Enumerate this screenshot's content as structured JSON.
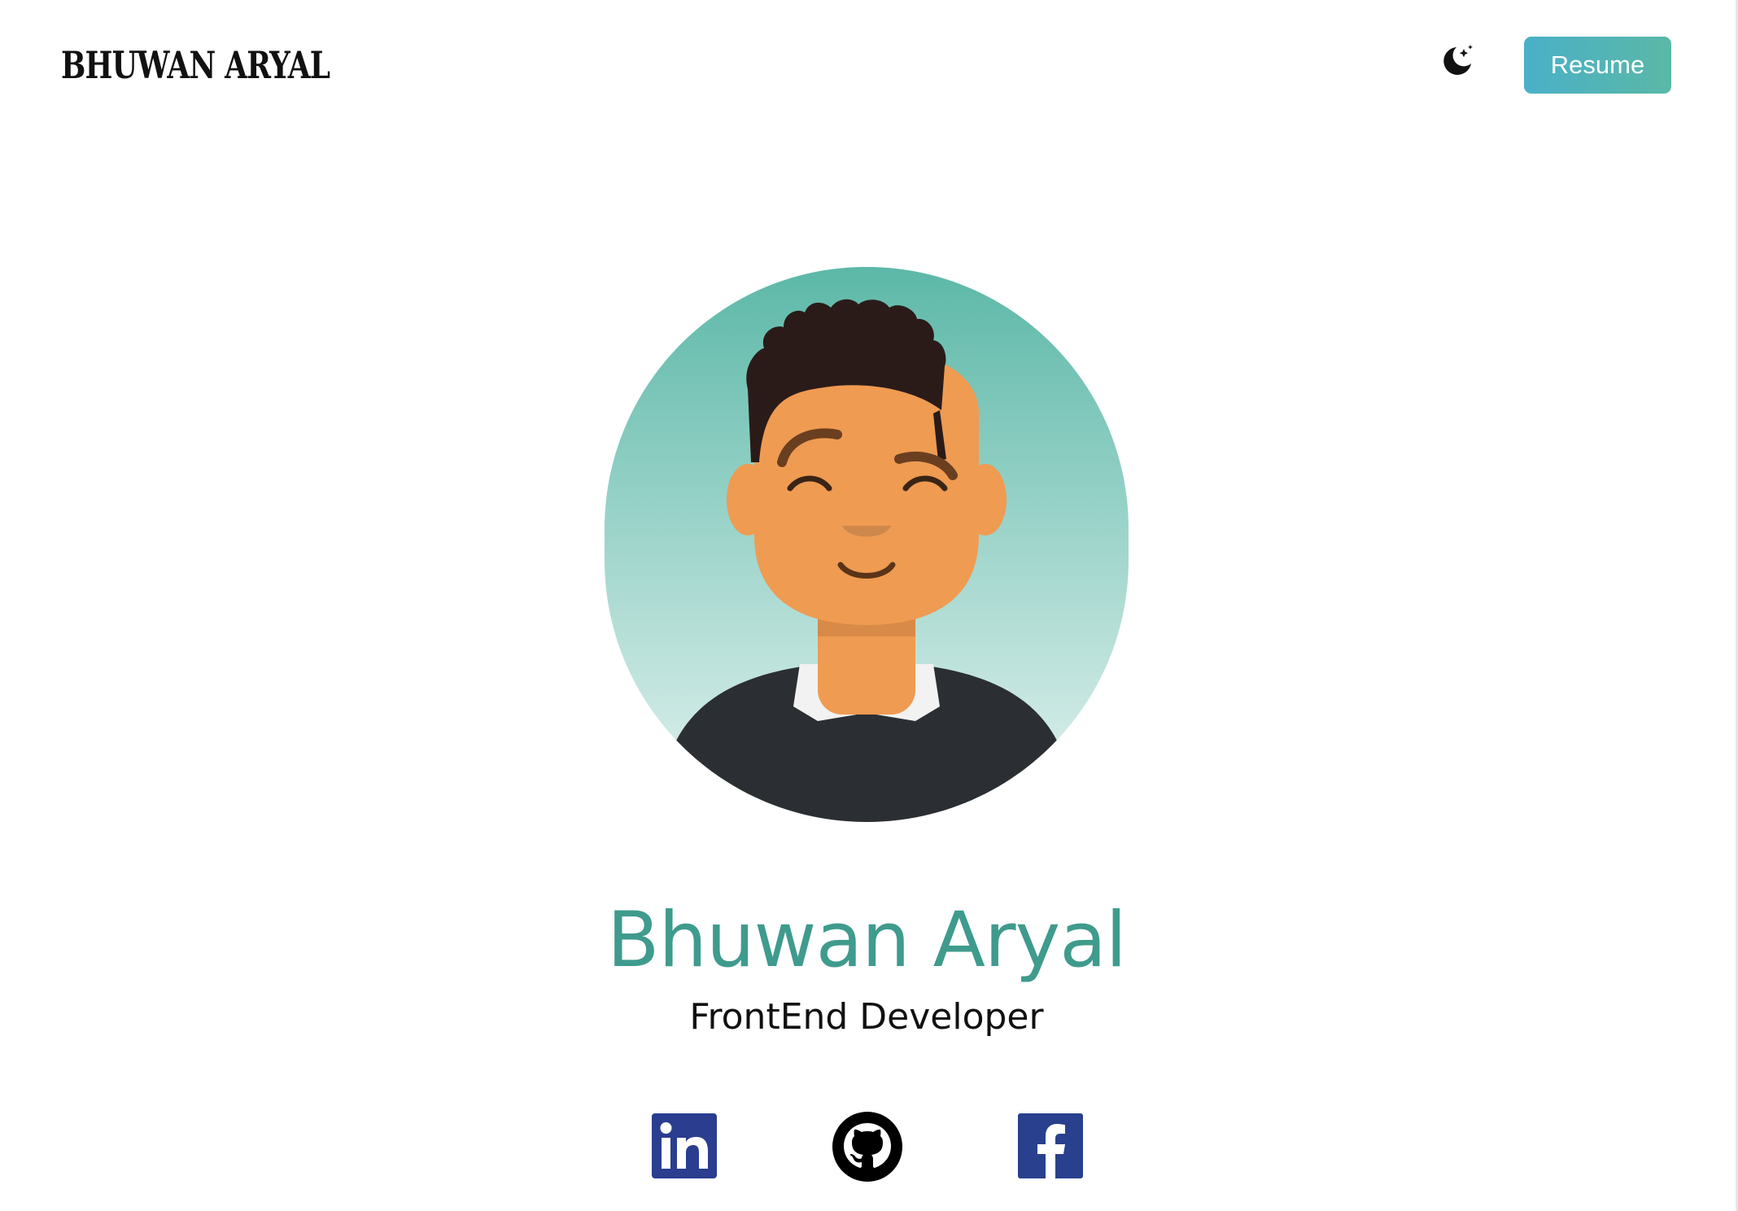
{
  "header": {
    "logo_text": "Bhuwan Aryal",
    "theme_toggle_icon": "moon-stars-icon",
    "resume_label": "Resume"
  },
  "hero": {
    "avatar_icon": "avatar-illustration",
    "name": "Bhuwan Aryal",
    "title": "FrontEnd Developer"
  },
  "social_links": [
    {
      "name": "LinkedIn",
      "icon": "linkedin-icon",
      "color": "#2a3d8f"
    },
    {
      "name": "GitHub",
      "icon": "github-icon",
      "color": "#000000"
    },
    {
      "name": "Facebook",
      "icon": "facebook-icon",
      "color": "#28408d"
    }
  ],
  "colors": {
    "accent": "#3f9b8d",
    "button_gradient_start": "#4ab0c8",
    "button_gradient_end": "#5ab8a6",
    "avatar_bg_top": "#5cb8a8",
    "avatar_bg_bottom": "#e4f3f0"
  }
}
